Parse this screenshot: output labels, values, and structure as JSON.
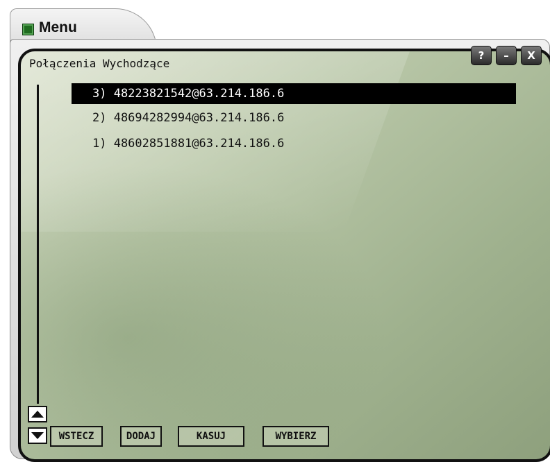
{
  "window": {
    "tab_title": "Menu",
    "panel_title": "Połączenia Wychodzące",
    "help_label": "?",
    "minimize_label": "–",
    "close_label": "X"
  },
  "calls": [
    {
      "label": "3) 48223821542@63.214.186.6",
      "selected": true
    },
    {
      "label": "2) 48694282994@63.214.186.6",
      "selected": false
    },
    {
      "label": "1) 48602851881@63.214.186.6",
      "selected": false
    }
  ],
  "buttons": {
    "back": "WSTECZ",
    "add": "DODAJ",
    "delete": "KASUJ",
    "select": "WYBIERZ"
  },
  "icons": {
    "tab_icon": "menu-app-icon",
    "scroll_up": "arrow-up-icon",
    "scroll_down": "arrow-down-icon"
  }
}
